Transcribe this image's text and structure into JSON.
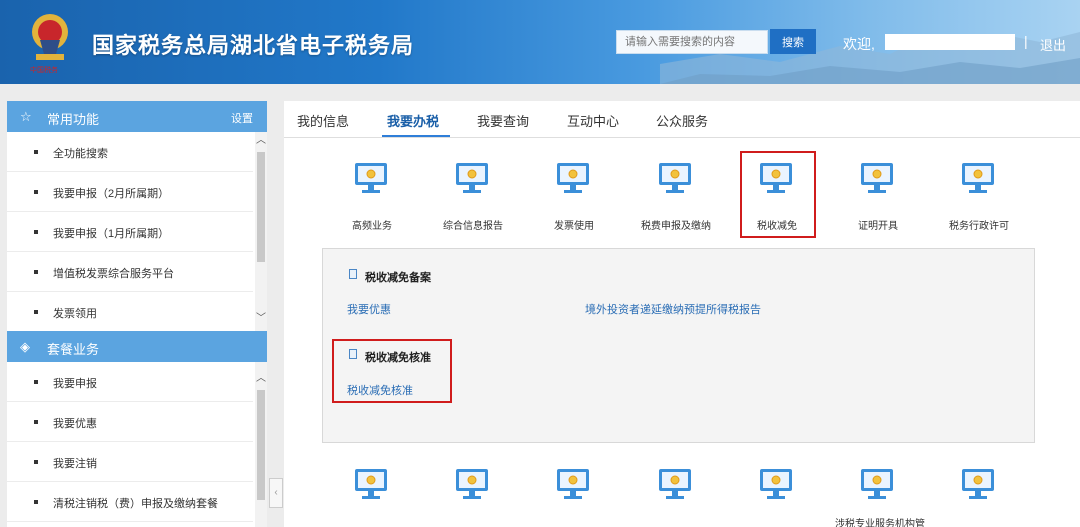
{
  "header": {
    "title": "国家税务总局湖北省电子税务局",
    "search_placeholder": "请输入需要搜索的内容",
    "search_button": "搜索",
    "welcome": "欢迎,",
    "divider": "|",
    "logout": "退出"
  },
  "sidebar": {
    "common": {
      "title": "常用功能",
      "settings": "设置",
      "items": [
        "全功能搜索",
        "我要申报（2月所属期）",
        "我要申报（1月所属期）",
        "增值税发票综合服务平台",
        "发票领用"
      ]
    },
    "package": {
      "title": "套餐业务",
      "items": [
        "我要申报",
        "我要优惠",
        "我要注销",
        "清税注销税（费）申报及缴纳套餐"
      ]
    }
  },
  "tabs": [
    "我的信息",
    "我要办税",
    "我要查询",
    "互动中心",
    "公众服务"
  ],
  "active_tab": "我要办税",
  "functions": [
    "高频业务",
    "综合信息报告",
    "发票使用",
    "税费申报及缴纳",
    "税收减免",
    "证明开具",
    "税务行政许可"
  ],
  "panel": {
    "section1_title": "税收减免备案",
    "section1_links": [
      "我要优惠",
      "境外投资者递延缴纳预提所得税报告"
    ],
    "section2_title": "税收减免核准",
    "section2_links": [
      "税收减免核准"
    ]
  },
  "bottom_partial_label": "涉税专业服务机构管",
  "colors": {
    "header_blue": "#1a63ad",
    "sidebar_header": "#5ba4e0",
    "link": "#2a6db5",
    "highlight_red": "#d01c1c"
  }
}
